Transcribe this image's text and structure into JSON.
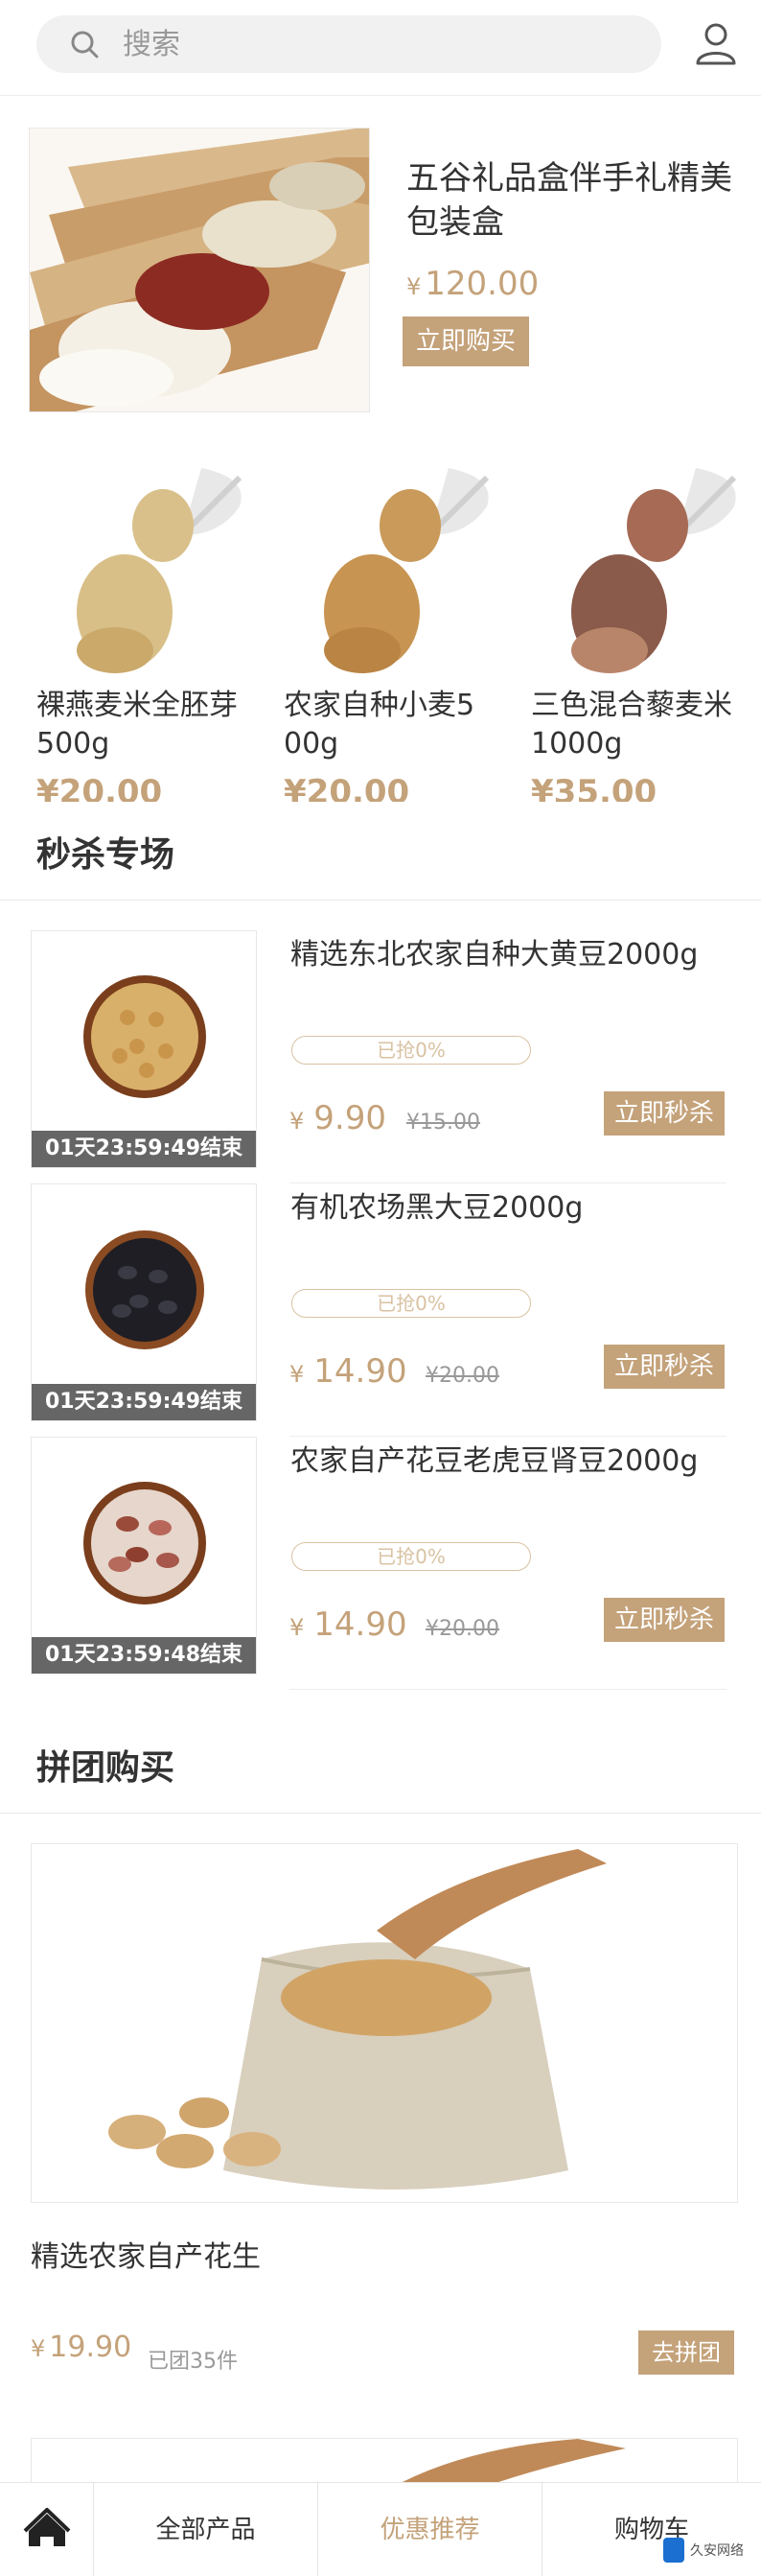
{
  "header": {
    "search_placeholder": "搜索"
  },
  "hero": {
    "title": "五谷礼品盒伴手礼精美包装盒",
    "currency": "¥",
    "price": "120.00",
    "buy_label": "立即购买"
  },
  "products": [
    {
      "name": "裸燕麦米全胚芽500g",
      "price": "¥20.00"
    },
    {
      "name": "农家自种小麦5 00g",
      "price": "¥20.00"
    },
    {
      "name": "三色混合藜麦米1000g",
      "price": "¥35.00"
    }
  ],
  "seckill": {
    "title": "秒杀专场",
    "items": [
      {
        "title": "精选东北农家自种大黄豆2000g",
        "progress": "已抢0%",
        "currency": "¥",
        "price": "9.90",
        "old_price": "¥15.00",
        "timer": "01天23:59:49结束",
        "btn": "立即秒杀"
      },
      {
        "title": "有机农场黑大豆2000g",
        "progress": "已抢0%",
        "currency": "¥",
        "price": "14.90",
        "old_price": "¥20.00",
        "timer": "01天23:59:49结束",
        "btn": "立即秒杀"
      },
      {
        "title": "农家自产花豆老虎豆肾豆2000g",
        "progress": "已抢0%",
        "currency": "¥",
        "price": "14.90",
        "old_price": "¥20.00",
        "timer": "01天23:59:48结束",
        "btn": "立即秒杀"
      }
    ]
  },
  "groupbuy": {
    "title": "拼团购买",
    "name": "精选农家自产花生",
    "currency": "¥",
    "price": "19.90",
    "count": "已团35件",
    "btn": "去拼团"
  },
  "nav": {
    "items": [
      "全部产品",
      "优惠推荐",
      "购物车"
    ],
    "active_index": 1
  },
  "watermark": {
    "text": "久安网络"
  },
  "colors": {
    "accent": "#c4a27a",
    "timer_bg": "#666666"
  }
}
